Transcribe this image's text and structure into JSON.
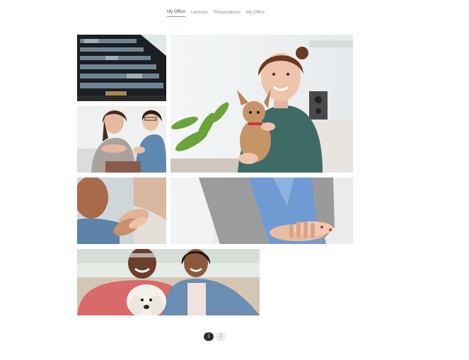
{
  "tabs": [
    {
      "label": "My Office",
      "active": true
    },
    {
      "label": "Lectures",
      "active": false
    },
    {
      "label": "Presentations",
      "active": false
    },
    {
      "label": "My Office",
      "active": false
    }
  ],
  "gallery": {
    "tiles": [
      {
        "name": "office-building-photo"
      },
      {
        "name": "woman-with-dog-photo"
      },
      {
        "name": "therapy-session-photo"
      },
      {
        "name": "holding-hands-photo"
      },
      {
        "name": "caring-hands-photo"
      },
      {
        "name": "couple-with-dog-photo"
      }
    ]
  },
  "pagination": {
    "pages": [
      "1",
      "2"
    ],
    "current": "1"
  }
}
